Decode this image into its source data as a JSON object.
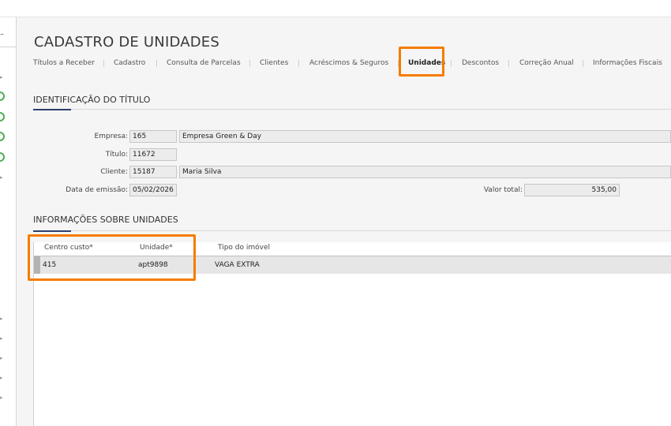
{
  "sidebar": {
    "top_glyph": "–"
  },
  "page": {
    "title": "CADASTRO DE UNIDADES"
  },
  "tabs": [
    {
      "label": "Títulos a Receber"
    },
    {
      "label": "Cadastro"
    },
    {
      "label": "Consulta de Parcelas"
    },
    {
      "label": "Clientes"
    },
    {
      "label": "Acréscimos & Seguros"
    },
    {
      "label": "Unidades",
      "active": true
    },
    {
      "label": "Descontos"
    },
    {
      "label": "Correção Anual"
    },
    {
      "label": "Informações Fiscais"
    }
  ],
  "identificacao": {
    "title": "IDENTIFICAÇÃO DO TÍTULO",
    "empresa_label": "Empresa:",
    "empresa_code": "165",
    "empresa_name": "Empresa Green & Day",
    "titulo_label": "Título:",
    "titulo_value": "11672",
    "cliente_label": "Cliente:",
    "cliente_code": "15187",
    "cliente_name": "Maria Silva",
    "data_label": "Data de emissão:",
    "data_value": "05/02/2026",
    "valor_label": "Valor total:",
    "valor_value": "535,00"
  },
  "unidades": {
    "title": "INFORMAÇÕES SOBRE UNIDADES",
    "columns": [
      "Centro custo*",
      "Unidade*",
      "Tipo do imóvel"
    ],
    "rows": [
      {
        "centro_custo": "415",
        "unidade": "apt9898",
        "tipo": "VAGA EXTRA"
      }
    ]
  },
  "colors": {
    "highlight": "#f57c00",
    "accent": "#2e3f6e",
    "status_ok": "#4caf50"
  }
}
